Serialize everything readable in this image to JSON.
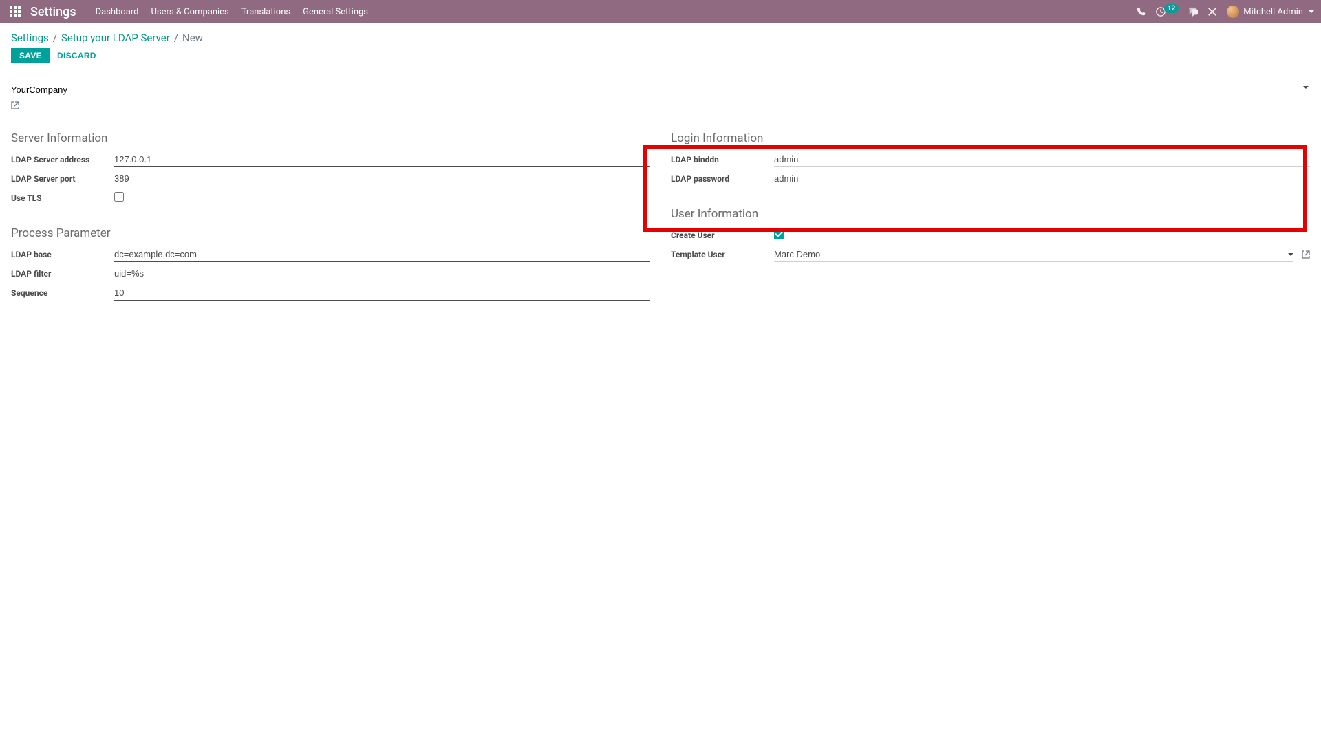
{
  "topnav": {
    "app_title": "Settings",
    "menu": [
      "Dashboard",
      "Users & Companies",
      "Translations",
      "General Settings"
    ],
    "activity_count": "12",
    "user_name": "Mitchell Admin"
  },
  "breadcrumbs": {
    "root": "Settings",
    "parent": "Setup your LDAP Server",
    "current": "New"
  },
  "actions": {
    "save": "SAVE",
    "discard": "DISCARD"
  },
  "company": {
    "value": "YourCompany"
  },
  "server_info": {
    "title": "Server Information",
    "address_label": "LDAP Server address",
    "address_value": "127.0.0.1",
    "port_label": "LDAP Server port",
    "port_value": "389",
    "tls_label": "Use TLS"
  },
  "login_info": {
    "title": "Login Information",
    "binddn_label": "LDAP binddn",
    "binddn_value": "admin",
    "password_label": "LDAP password",
    "password_value": "admin"
  },
  "process_param": {
    "title": "Process Parameter",
    "base_label": "LDAP base",
    "base_value": "dc=example,dc=com",
    "filter_label": "LDAP filter",
    "filter_value": "uid=%s",
    "sequence_label": "Sequence",
    "sequence_value": "10"
  },
  "user_info": {
    "title": "User Information",
    "create_user_label": "Create User",
    "template_user_label": "Template User",
    "template_user_value": "Marc Demo"
  }
}
